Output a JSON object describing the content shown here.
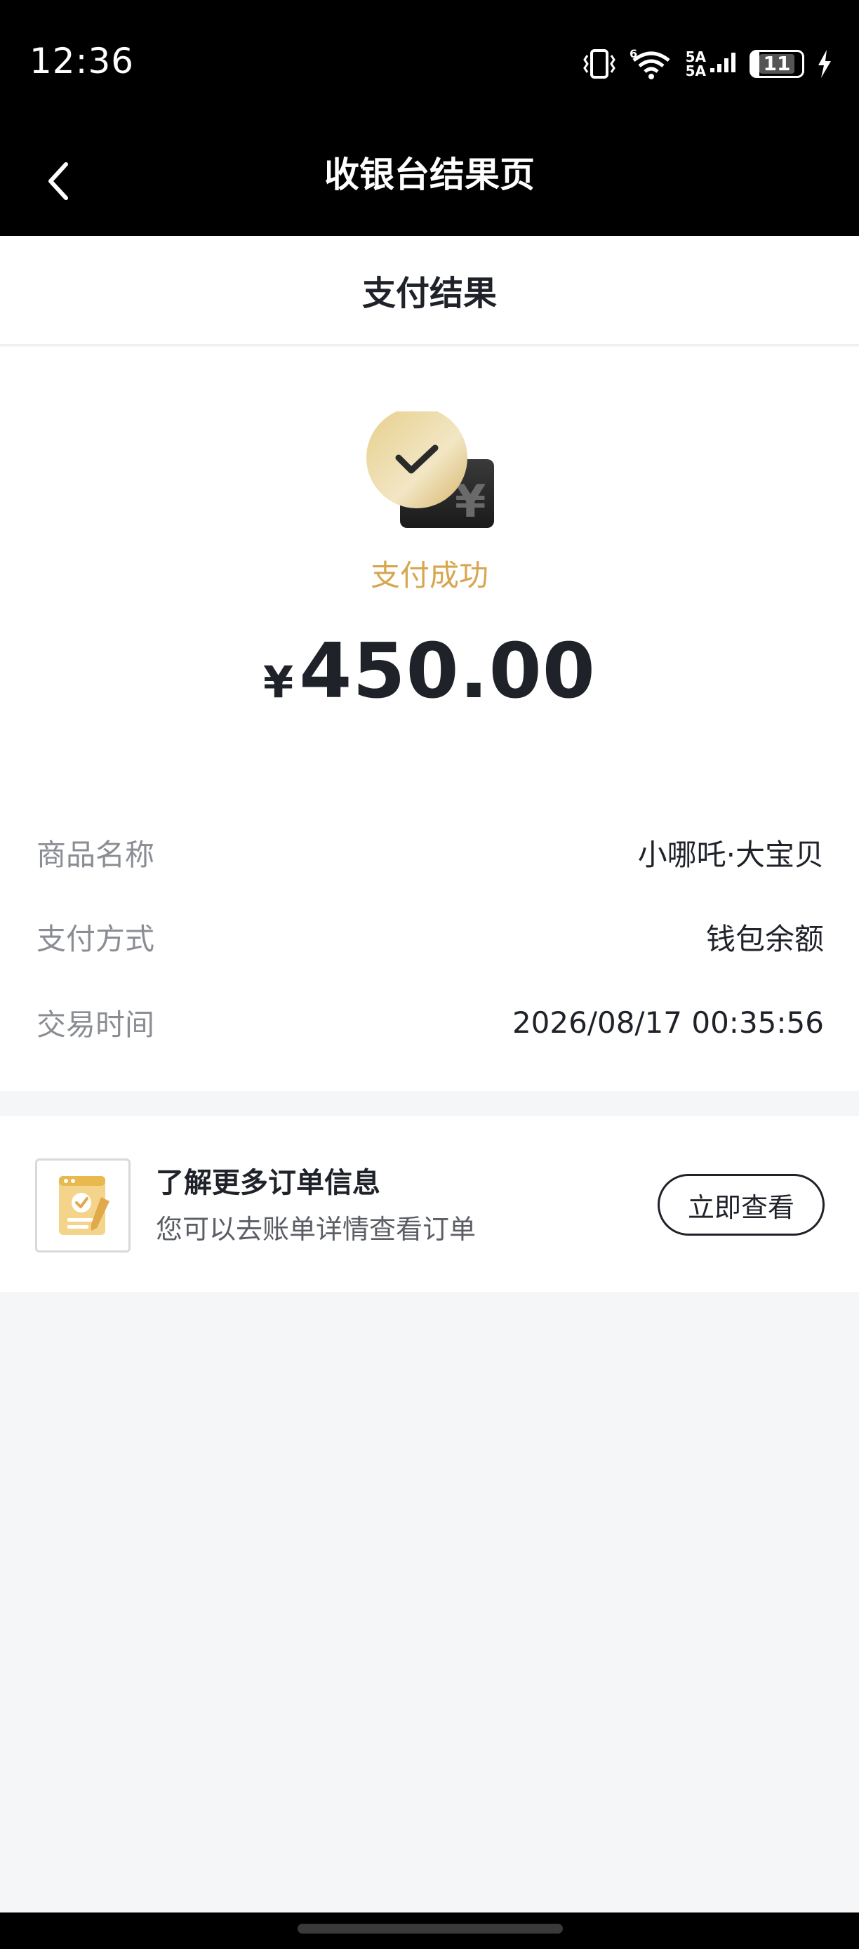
{
  "status_bar": {
    "time": "12:36",
    "network_top": "5A",
    "network_bottom": "5A",
    "wifi_badge": "6",
    "battery_level": "11",
    "icons": [
      "vibrate-icon",
      "wifi-icon",
      "signal-icon",
      "battery-icon",
      "charging-icon"
    ]
  },
  "nav": {
    "title": "收银台结果页",
    "back_icon": "chevron-left-icon"
  },
  "sub_header": {
    "title": "支付结果"
  },
  "result": {
    "status_text": "支付成功",
    "currency_symbol": "¥",
    "amount": "450.00",
    "status_color": "#d7a64f",
    "details": [
      {
        "label": "商品名称",
        "value": "小哪吒·大宝贝"
      },
      {
        "label": "支付方式",
        "value": "钱包余额"
      },
      {
        "label": "交易时间",
        "value": "2026/08/17 00:35:56"
      }
    ]
  },
  "order_info": {
    "title": "了解更多订单信息",
    "description": "您可以去账单详情查看订单",
    "button_label": "立即查看",
    "icon": "document-check-icon"
  }
}
